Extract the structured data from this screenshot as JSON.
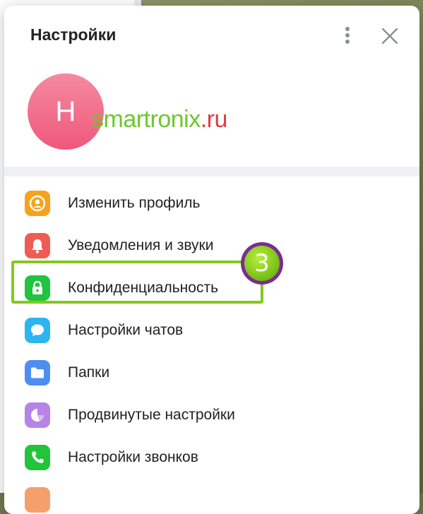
{
  "modal": {
    "title": "Настройки"
  },
  "profile": {
    "avatar_letter": "H"
  },
  "watermark": {
    "main": "smartronix",
    "tld": ".ru"
  },
  "menu": {
    "items": [
      {
        "label": "Изменить профиль",
        "icon": "user-icon",
        "color": "#f6a31c"
      },
      {
        "label": "Уведомления и звуки",
        "icon": "bell-icon",
        "color": "#ef5b55"
      },
      {
        "label": "Конфиденциальность",
        "icon": "lock-icon",
        "color": "#1fc43f"
      },
      {
        "label": "Настройки чатов",
        "icon": "chat-bubble-icon",
        "color": "#2eb5ef"
      },
      {
        "label": "Папки",
        "icon": "folder-icon",
        "color": "#4f8ef1"
      },
      {
        "label": "Продвинутые настройки",
        "icon": "pie-chart-icon",
        "color": "#b783e6"
      },
      {
        "label": "Настройки звонков",
        "icon": "phone-icon",
        "color": "#22c43a"
      }
    ]
  },
  "annotation": {
    "step_number": "3",
    "highlight_color": "#83c820"
  }
}
